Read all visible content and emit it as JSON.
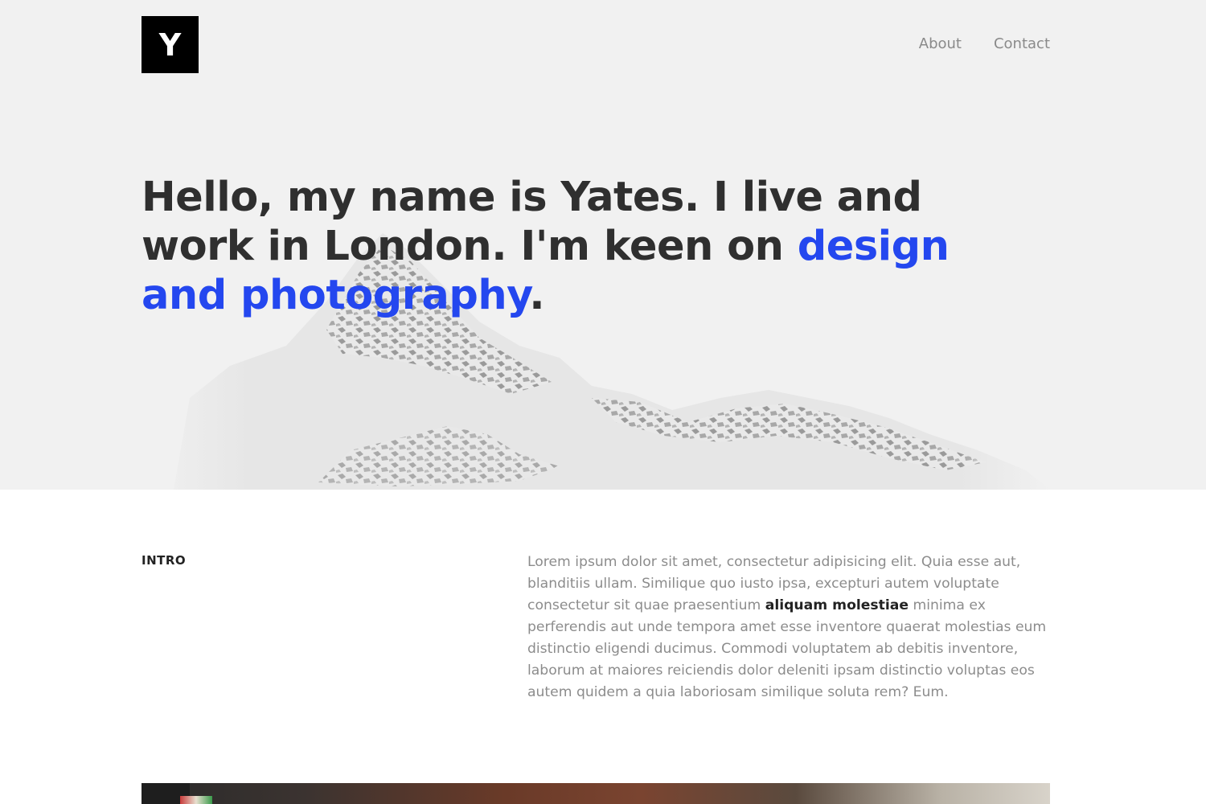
{
  "header": {
    "logo_letter": "Y",
    "nav": [
      {
        "label": "About"
      },
      {
        "label": "Contact"
      }
    ]
  },
  "hero": {
    "headline_part1": "Hello, my name is Yates. I live and work in London. I'm keen on ",
    "headline_accent": "design and photography",
    "headline_end": ".",
    "accent_color": "#2447ef",
    "background_image": "snowy-mountain"
  },
  "intro": {
    "label": "INTRO",
    "text_before": "Lorem ipsum dolor sit amet, consectetur adipisicing elit. Quia esse aut, blanditiis ullam. Similique quo iusto ipsa, excepturi autem voluptate consectetur sit quae praesentium ",
    "text_bold": "aliquam molestiae",
    "text_after": " minima ex perferendis aut unde tempora amet esse inventore quaerat molestias eum distinctio eligendi ducimus. Commodi voluptatem ab debitis inventore, laborum at maiores reiciendis dolor deleniti ipsam distinctio voluptas eos autem quidem a quia laboriosam similique soluta rem? Eum."
  },
  "gallery": {
    "image": "photo-preview"
  }
}
